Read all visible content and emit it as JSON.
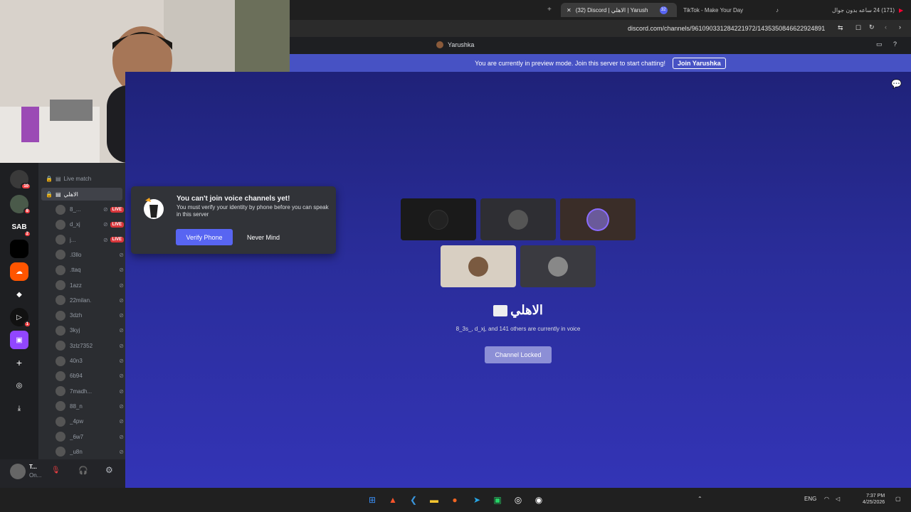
{
  "browser": {
    "tabs": [
      {
        "label": "(32) Discord | الاهلي | Yarush",
        "badge": "32"
      },
      {
        "label": "TikTok - Make Your Day"
      },
      {
        "label": "(171) 24 ساعه بدون جوال"
      }
    ],
    "new_tab_glyph": "+",
    "url": "discord.com/channels/961090331284221972/1435350846622924891"
  },
  "discord": {
    "server_title": "Yarushka",
    "banner_text": "You are currently in preview mode. Join this server to start chatting!",
    "join_label": "Join Yarushka"
  },
  "servers": [
    {
      "label": "",
      "badge": "10"
    },
    {
      "label": "",
      "badge": "8"
    },
    {
      "label": "SAB",
      "badge": "2"
    },
    {
      "label": ""
    },
    {
      "label": ""
    },
    {
      "label": ""
    },
    {
      "label": "",
      "badge": "1"
    },
    {
      "label": ""
    }
  ],
  "channels": {
    "live_match": "Live match",
    "selected": "الاهلي",
    "live_badge": "LIVE",
    "voice_users": [
      {
        "name": "8_...",
        "live": true
      },
      {
        "name": "d_xj",
        "live": true
      },
      {
        "name": "j...",
        "live": true
      },
      {
        "name": ".l3llo",
        "live": false
      },
      {
        "name": ".ttaq",
        "live": false
      },
      {
        "name": "1azz",
        "live": false
      },
      {
        "name": "22milan.",
        "live": false
      },
      {
        "name": "3dzh",
        "live": false
      },
      {
        "name": "3kyj",
        "live": false
      },
      {
        "name": "3zlz7352",
        "live": false
      },
      {
        "name": "40n3",
        "live": false
      },
      {
        "name": "6b94",
        "live": false
      },
      {
        "name": "7madh...",
        "live": false
      },
      {
        "name": "88_n",
        "live": false
      },
      {
        "name": "_4pw",
        "live": false
      },
      {
        "name": "_6w7",
        "live": false
      },
      {
        "name": "_u8n",
        "live": false
      }
    ]
  },
  "user_panel": {
    "name": "T...",
    "status": "On..."
  },
  "popup": {
    "title": "You can't join voice channels yet!",
    "description": "You must verify your identity by phone before you can speak in this server",
    "verify_label": "Verify Phone",
    "never_mind_label": "Never Mind"
  },
  "voice_stage": {
    "channel_name": "الاهلي",
    "description": "8_3s_, d_xj, and 141 others are currently in voice",
    "locked_label": "Channel Locked"
  },
  "taskbar": {
    "time": "7:37 PM",
    "date": "4/25/2026",
    "lang": "ENG"
  },
  "colors": {
    "blurple": "#5865f2",
    "banner": "#4752c4",
    "live_red": "#da373c",
    "stage_bg": "#2a2d9a"
  }
}
